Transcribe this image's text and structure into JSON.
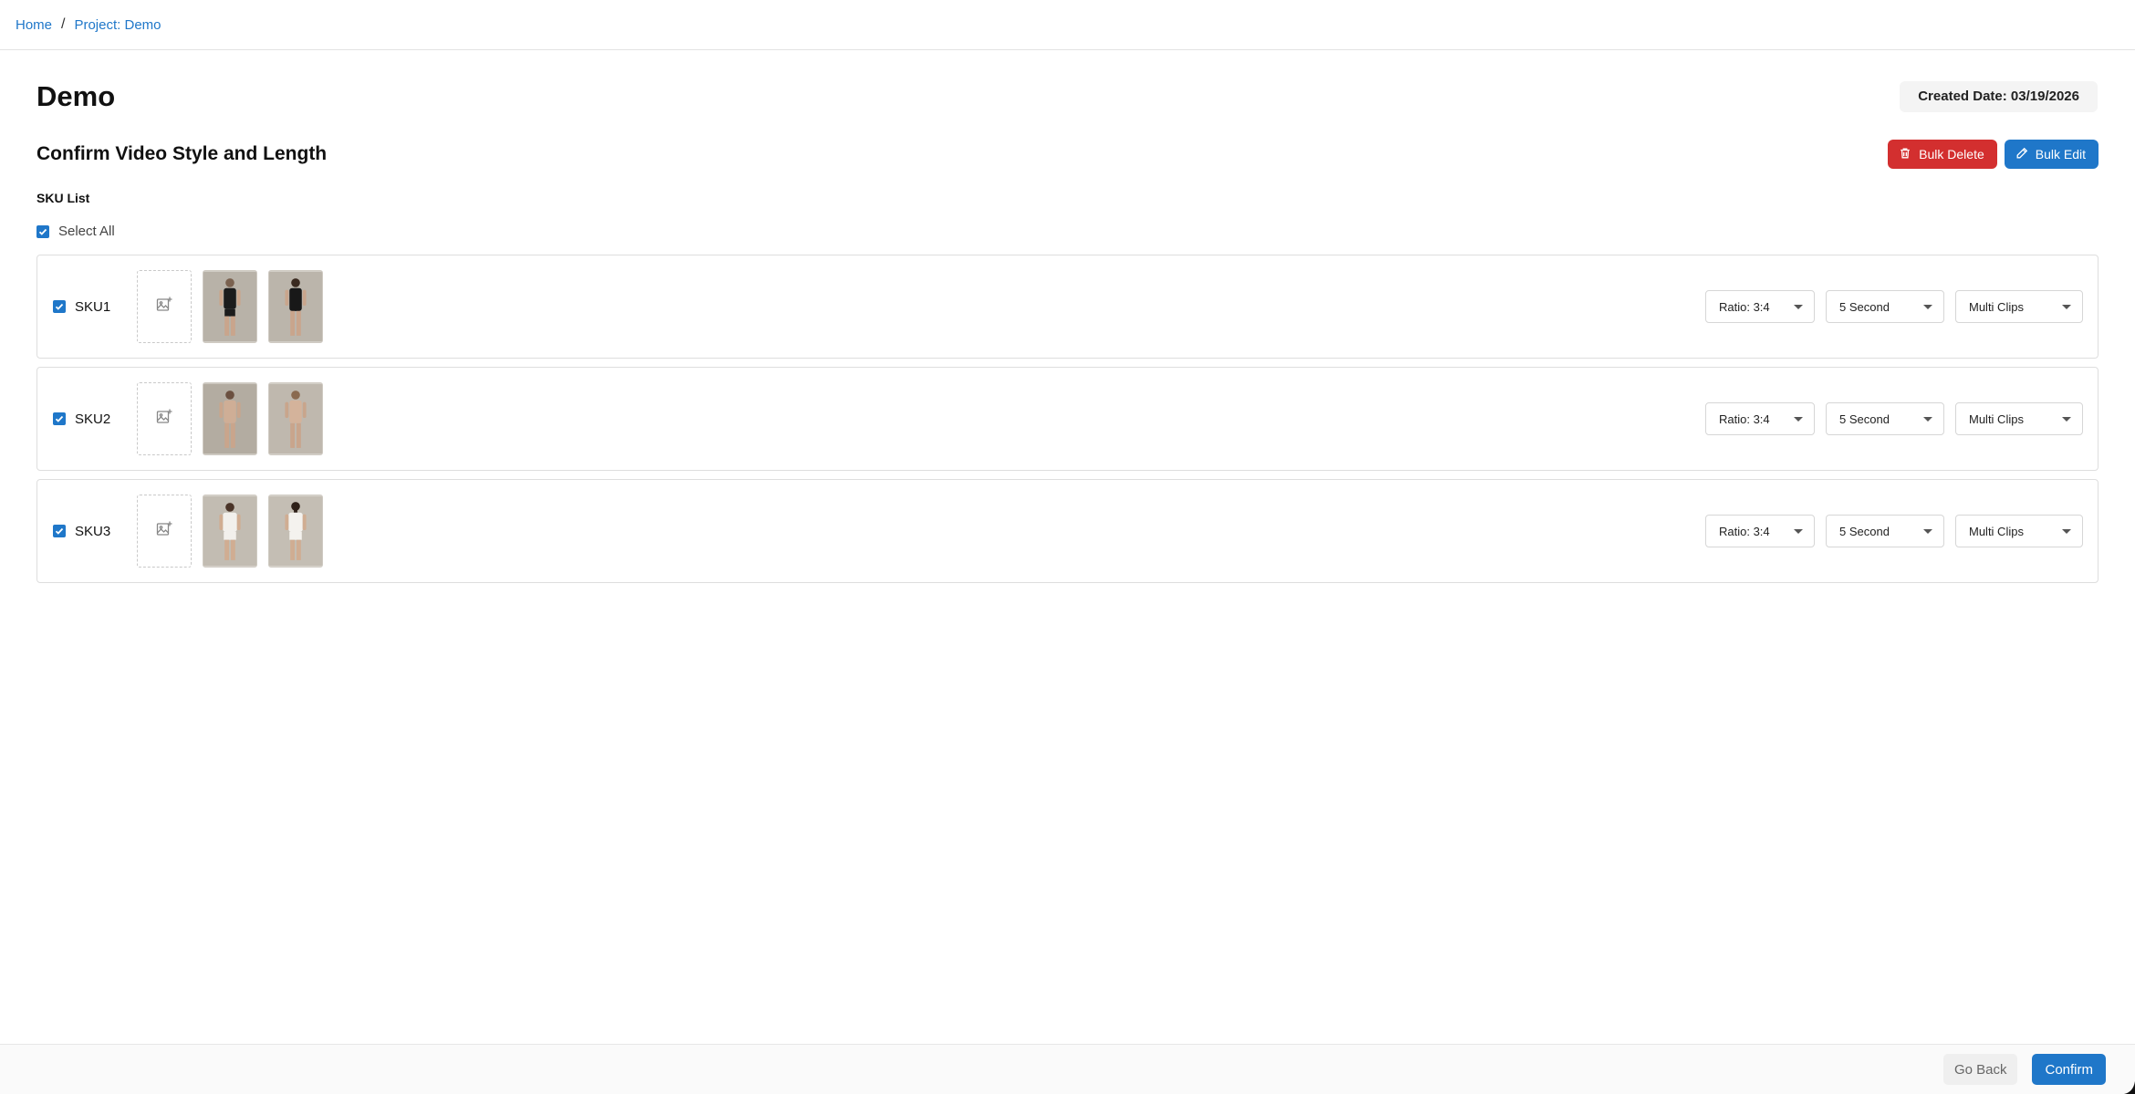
{
  "breadcrumb": {
    "home": "Home",
    "separator": "/",
    "project": "Project: Demo"
  },
  "page": {
    "title": "Demo",
    "created": "Created Date: 03/19/2026"
  },
  "section": {
    "title": "Confirm Video Style and Length",
    "bulk_delete": "Bulk Delete",
    "bulk_edit": "Bulk Edit"
  },
  "sku_list": {
    "label": "SKU List",
    "select_all": "Select All",
    "select_all_checked": true
  },
  "skus": [
    {
      "name": "SKU1",
      "checked": true,
      "ratio": "Ratio: 3:4",
      "length": "5 Second",
      "style": "Multi Clips",
      "images": [
        "model-front-black-outfit",
        "model-back-black-outfit"
      ]
    },
    {
      "name": "SKU2",
      "checked": true,
      "ratio": "Ratio: 3:4",
      "length": "5 Second",
      "style": "Multi Clips",
      "images": [
        "model-front-nude-bodysuit",
        "model-back-nude-bodysuit"
      ]
    },
    {
      "name": "SKU3",
      "checked": true,
      "ratio": "Ratio: 3:4",
      "length": "5 Second",
      "style": "Multi Clips",
      "images": [
        "model-front-white-outfit",
        "model-back-white-outfit"
      ]
    }
  ],
  "footer": {
    "go_back": "Go Back",
    "confirm": "Confirm"
  },
  "colors": {
    "primary": "#1f77c9",
    "danger": "#d32f2f"
  }
}
